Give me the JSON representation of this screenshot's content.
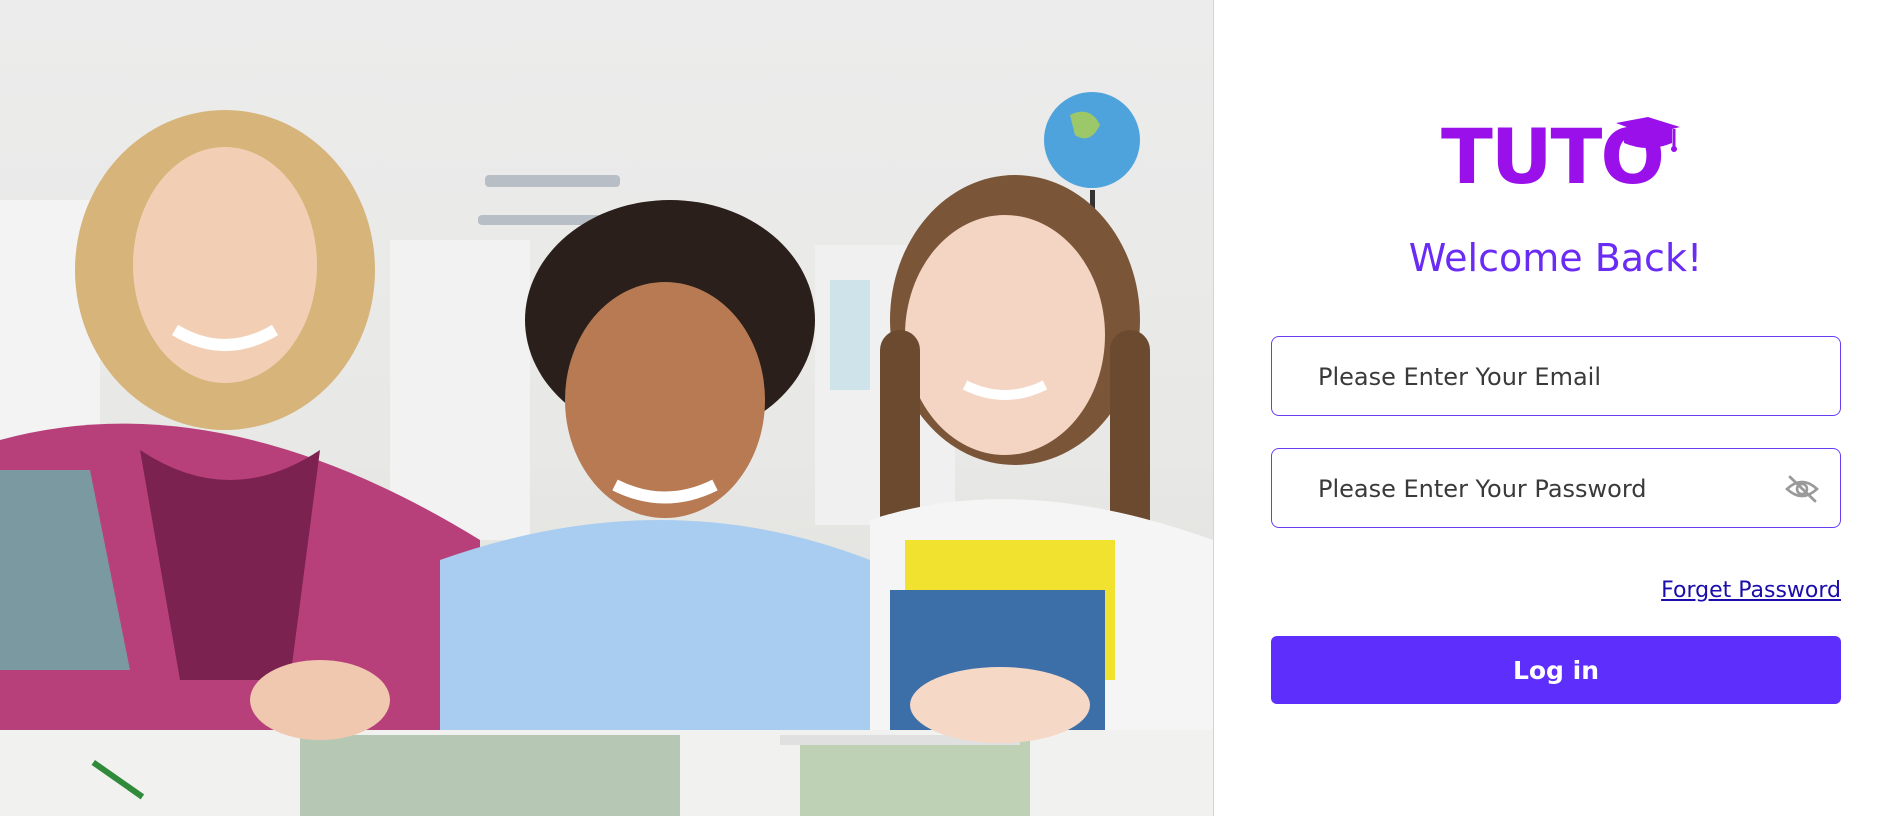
{
  "photo": {
    "description_icon": "classroom-kids-photo"
  },
  "brand": {
    "logo_text": "TUTO",
    "logo_color": "#9a10ea"
  },
  "login": {
    "heading": "Welcome Back!",
    "email_placeholder": "Please Enter Your Email",
    "email_value": "",
    "password_placeholder": "Please Enter Your Password",
    "password_value": "",
    "password_toggle_icon": "eye-slash-icon",
    "forgot_label": "Forget Password",
    "submit_label": "Log in",
    "accent_color": "#5d2efc",
    "heading_color": "#6a2cf5"
  }
}
